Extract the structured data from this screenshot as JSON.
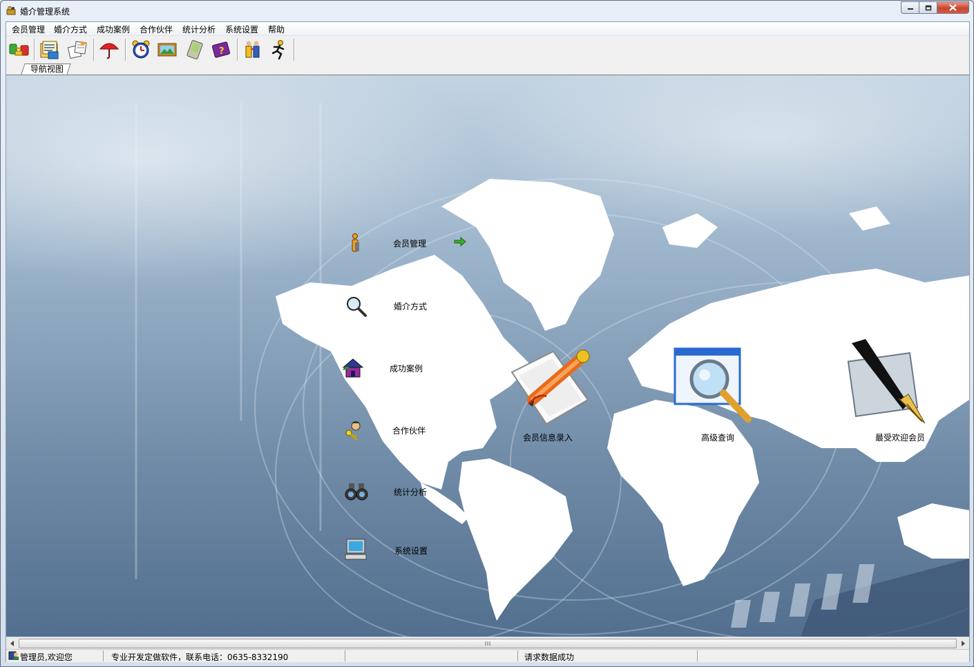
{
  "window": {
    "title": "婚介管理系统",
    "min_icon": "minimize-icon",
    "max_icon": "maximize-icon",
    "close_icon": "close-icon"
  },
  "menu": [
    "会员管理",
    "婚介方式",
    "成功案例",
    "合作伙伴",
    "统计分析",
    "系统设置",
    "帮助"
  ],
  "toolbar": {
    "icons": [
      "connect-icon",
      "folder-stack-icon",
      "papers-icon",
      "umbrella-icon",
      "alarm-clock-icon",
      "picture-frame-icon",
      "pda-icon",
      "help-book-icon",
      "people-icon",
      "running-man-icon"
    ]
  },
  "tab": {
    "label": "导航视图"
  },
  "nav": [
    {
      "label": "会员管理",
      "icon": "info-person-icon"
    },
    {
      "label": "婚介方式",
      "icon": "magnifier-icon"
    },
    {
      "label": "成功案例",
      "icon": "house-icon"
    },
    {
      "label": "合作伙伴",
      "icon": "partners-icon"
    },
    {
      "label": "统计分析",
      "icon": "binoculars-icon"
    },
    {
      "label": "系统设置",
      "icon": "computer-icon"
    }
  ],
  "quick": [
    {
      "label": "会员信息录入",
      "icon": "document-pen-icon"
    },
    {
      "label": "高级查询",
      "icon": "search-window-icon"
    },
    {
      "label": "最受欢迎会员",
      "icon": "fountain-pen-icon"
    }
  ],
  "colors": {
    "accent": "#5d82a8",
    "arrow": "#3cae2c"
  },
  "status": {
    "user": "管理员,欢迎您",
    "contact": "专业开发定做软件，联系电话：0635-8332190",
    "message": "请求数据成功"
  }
}
